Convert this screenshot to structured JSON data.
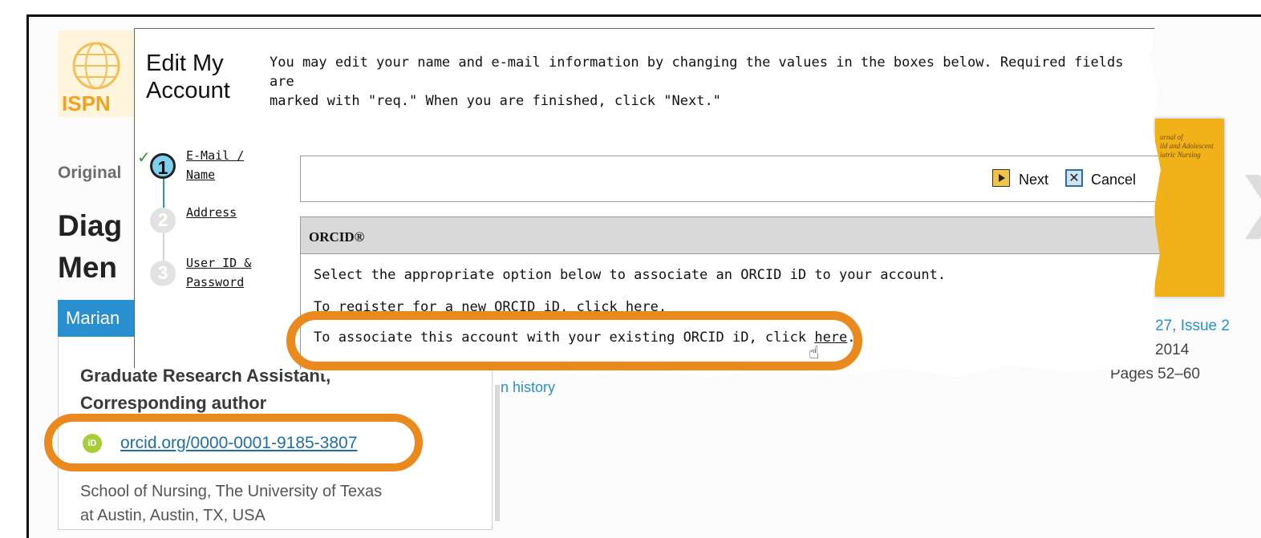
{
  "background_page": {
    "logo_text": "ISPN",
    "article_type_fragment": "Original",
    "title_fragments": [
      "Diag",
      "Men"
    ],
    "author_name_fragment": "Marian",
    "author_roles": [
      "Graduate Research Assistant,",
      "Corresponding author"
    ],
    "orcid_link": "orcid.org/0000-0001-9185-3807",
    "orcid_icon_text": "iD",
    "affiliation": [
      "School of Nursing, The University of Texas",
      "at Austin, Austin, TX, USA"
    ],
    "history_link_fragment": "n history",
    "issue_fragment": "27, Issue 2",
    "year_fragment": "2014",
    "pages": "Pages 52–60",
    "journal_cover_text": "urnal of\nild and Adolescent\niatric Nursing"
  },
  "modal": {
    "title_line1": "Edit My",
    "title_line2": "Account",
    "intro_line1": "You may edit your name and e-mail information by changing the values in the boxes below. Required fields are",
    "intro_line2": "marked with \"req.\" When you are finished, click \"Next.\"",
    "steps": [
      {
        "number": "1",
        "label_line1": "E-Mail /",
        "label_line2": "Name",
        "status": "complete"
      },
      {
        "number": "2",
        "label_line1": "Address",
        "label_line2": "",
        "status": "pending"
      },
      {
        "number": "3",
        "label_line1": "User ID &",
        "label_line2": "Password",
        "status": "pending"
      }
    ],
    "next_label": "Next",
    "cancel_label": "Cancel",
    "orcid_section": {
      "header": "ORCID®",
      "instruction": "Select the appropriate option below to associate an ORCID iD to your account.",
      "register_prefix": "To register for a new ORCID iD, click here.",
      "existing_prefix": "To associate this account with your existing ORCID iD, click ",
      "existing_link": "here",
      "existing_suffix": "."
    }
  },
  "colors": {
    "callout_orange": "#ea8a1e",
    "link_blue": "#2a8fcf",
    "orcid_green": "#a6ce39",
    "step_active": "#7ed1ee"
  }
}
